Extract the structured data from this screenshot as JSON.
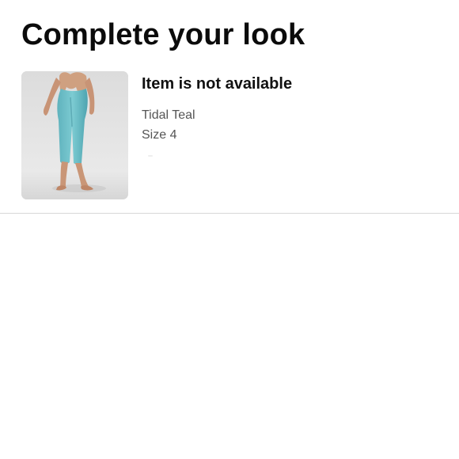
{
  "section": {
    "title": "Complete your look"
  },
  "product": {
    "availability_text": "Item is not available",
    "colour": "Tidal Teal",
    "size": "Size 4",
    "image_description": "model wearing teal cropped leggings"
  },
  "colors": {
    "background": "#ffffff",
    "text_primary": "#111111",
    "text_secondary": "#555555",
    "divider": "#d7d7d7",
    "product_teal": "#6cbfc7"
  }
}
